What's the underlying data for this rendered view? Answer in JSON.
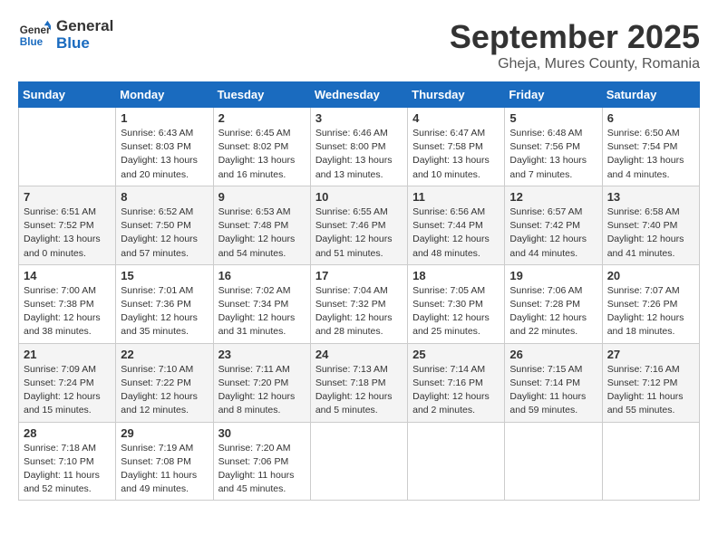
{
  "header": {
    "logo_general": "General",
    "logo_blue": "Blue",
    "month": "September 2025",
    "location": "Gheja, Mures County, Romania"
  },
  "weekdays": [
    "Sunday",
    "Monday",
    "Tuesday",
    "Wednesday",
    "Thursday",
    "Friday",
    "Saturday"
  ],
  "weeks": [
    [
      {
        "day": "",
        "info": ""
      },
      {
        "day": "1",
        "info": "Sunrise: 6:43 AM\nSunset: 8:03 PM\nDaylight: 13 hours\nand 20 minutes."
      },
      {
        "day": "2",
        "info": "Sunrise: 6:45 AM\nSunset: 8:02 PM\nDaylight: 13 hours\nand 16 minutes."
      },
      {
        "day": "3",
        "info": "Sunrise: 6:46 AM\nSunset: 8:00 PM\nDaylight: 13 hours\nand 13 minutes."
      },
      {
        "day": "4",
        "info": "Sunrise: 6:47 AM\nSunset: 7:58 PM\nDaylight: 13 hours\nand 10 minutes."
      },
      {
        "day": "5",
        "info": "Sunrise: 6:48 AM\nSunset: 7:56 PM\nDaylight: 13 hours\nand 7 minutes."
      },
      {
        "day": "6",
        "info": "Sunrise: 6:50 AM\nSunset: 7:54 PM\nDaylight: 13 hours\nand 4 minutes."
      }
    ],
    [
      {
        "day": "7",
        "info": "Sunrise: 6:51 AM\nSunset: 7:52 PM\nDaylight: 13 hours\nand 0 minutes."
      },
      {
        "day": "8",
        "info": "Sunrise: 6:52 AM\nSunset: 7:50 PM\nDaylight: 12 hours\nand 57 minutes."
      },
      {
        "day": "9",
        "info": "Sunrise: 6:53 AM\nSunset: 7:48 PM\nDaylight: 12 hours\nand 54 minutes."
      },
      {
        "day": "10",
        "info": "Sunrise: 6:55 AM\nSunset: 7:46 PM\nDaylight: 12 hours\nand 51 minutes."
      },
      {
        "day": "11",
        "info": "Sunrise: 6:56 AM\nSunset: 7:44 PM\nDaylight: 12 hours\nand 48 minutes."
      },
      {
        "day": "12",
        "info": "Sunrise: 6:57 AM\nSunset: 7:42 PM\nDaylight: 12 hours\nand 44 minutes."
      },
      {
        "day": "13",
        "info": "Sunrise: 6:58 AM\nSunset: 7:40 PM\nDaylight: 12 hours\nand 41 minutes."
      }
    ],
    [
      {
        "day": "14",
        "info": "Sunrise: 7:00 AM\nSunset: 7:38 PM\nDaylight: 12 hours\nand 38 minutes."
      },
      {
        "day": "15",
        "info": "Sunrise: 7:01 AM\nSunset: 7:36 PM\nDaylight: 12 hours\nand 35 minutes."
      },
      {
        "day": "16",
        "info": "Sunrise: 7:02 AM\nSunset: 7:34 PM\nDaylight: 12 hours\nand 31 minutes."
      },
      {
        "day": "17",
        "info": "Sunrise: 7:04 AM\nSunset: 7:32 PM\nDaylight: 12 hours\nand 28 minutes."
      },
      {
        "day": "18",
        "info": "Sunrise: 7:05 AM\nSunset: 7:30 PM\nDaylight: 12 hours\nand 25 minutes."
      },
      {
        "day": "19",
        "info": "Sunrise: 7:06 AM\nSunset: 7:28 PM\nDaylight: 12 hours\nand 22 minutes."
      },
      {
        "day": "20",
        "info": "Sunrise: 7:07 AM\nSunset: 7:26 PM\nDaylight: 12 hours\nand 18 minutes."
      }
    ],
    [
      {
        "day": "21",
        "info": "Sunrise: 7:09 AM\nSunset: 7:24 PM\nDaylight: 12 hours\nand 15 minutes."
      },
      {
        "day": "22",
        "info": "Sunrise: 7:10 AM\nSunset: 7:22 PM\nDaylight: 12 hours\nand 12 minutes."
      },
      {
        "day": "23",
        "info": "Sunrise: 7:11 AM\nSunset: 7:20 PM\nDaylight: 12 hours\nand 8 minutes."
      },
      {
        "day": "24",
        "info": "Sunrise: 7:13 AM\nSunset: 7:18 PM\nDaylight: 12 hours\nand 5 minutes."
      },
      {
        "day": "25",
        "info": "Sunrise: 7:14 AM\nSunset: 7:16 PM\nDaylight: 12 hours\nand 2 minutes."
      },
      {
        "day": "26",
        "info": "Sunrise: 7:15 AM\nSunset: 7:14 PM\nDaylight: 11 hours\nand 59 minutes."
      },
      {
        "day": "27",
        "info": "Sunrise: 7:16 AM\nSunset: 7:12 PM\nDaylight: 11 hours\nand 55 minutes."
      }
    ],
    [
      {
        "day": "28",
        "info": "Sunrise: 7:18 AM\nSunset: 7:10 PM\nDaylight: 11 hours\nand 52 minutes."
      },
      {
        "day": "29",
        "info": "Sunrise: 7:19 AM\nSunset: 7:08 PM\nDaylight: 11 hours\nand 49 minutes."
      },
      {
        "day": "30",
        "info": "Sunrise: 7:20 AM\nSunset: 7:06 PM\nDaylight: 11 hours\nand 45 minutes."
      },
      {
        "day": "",
        "info": ""
      },
      {
        "day": "",
        "info": ""
      },
      {
        "day": "",
        "info": ""
      },
      {
        "day": "",
        "info": ""
      }
    ]
  ]
}
